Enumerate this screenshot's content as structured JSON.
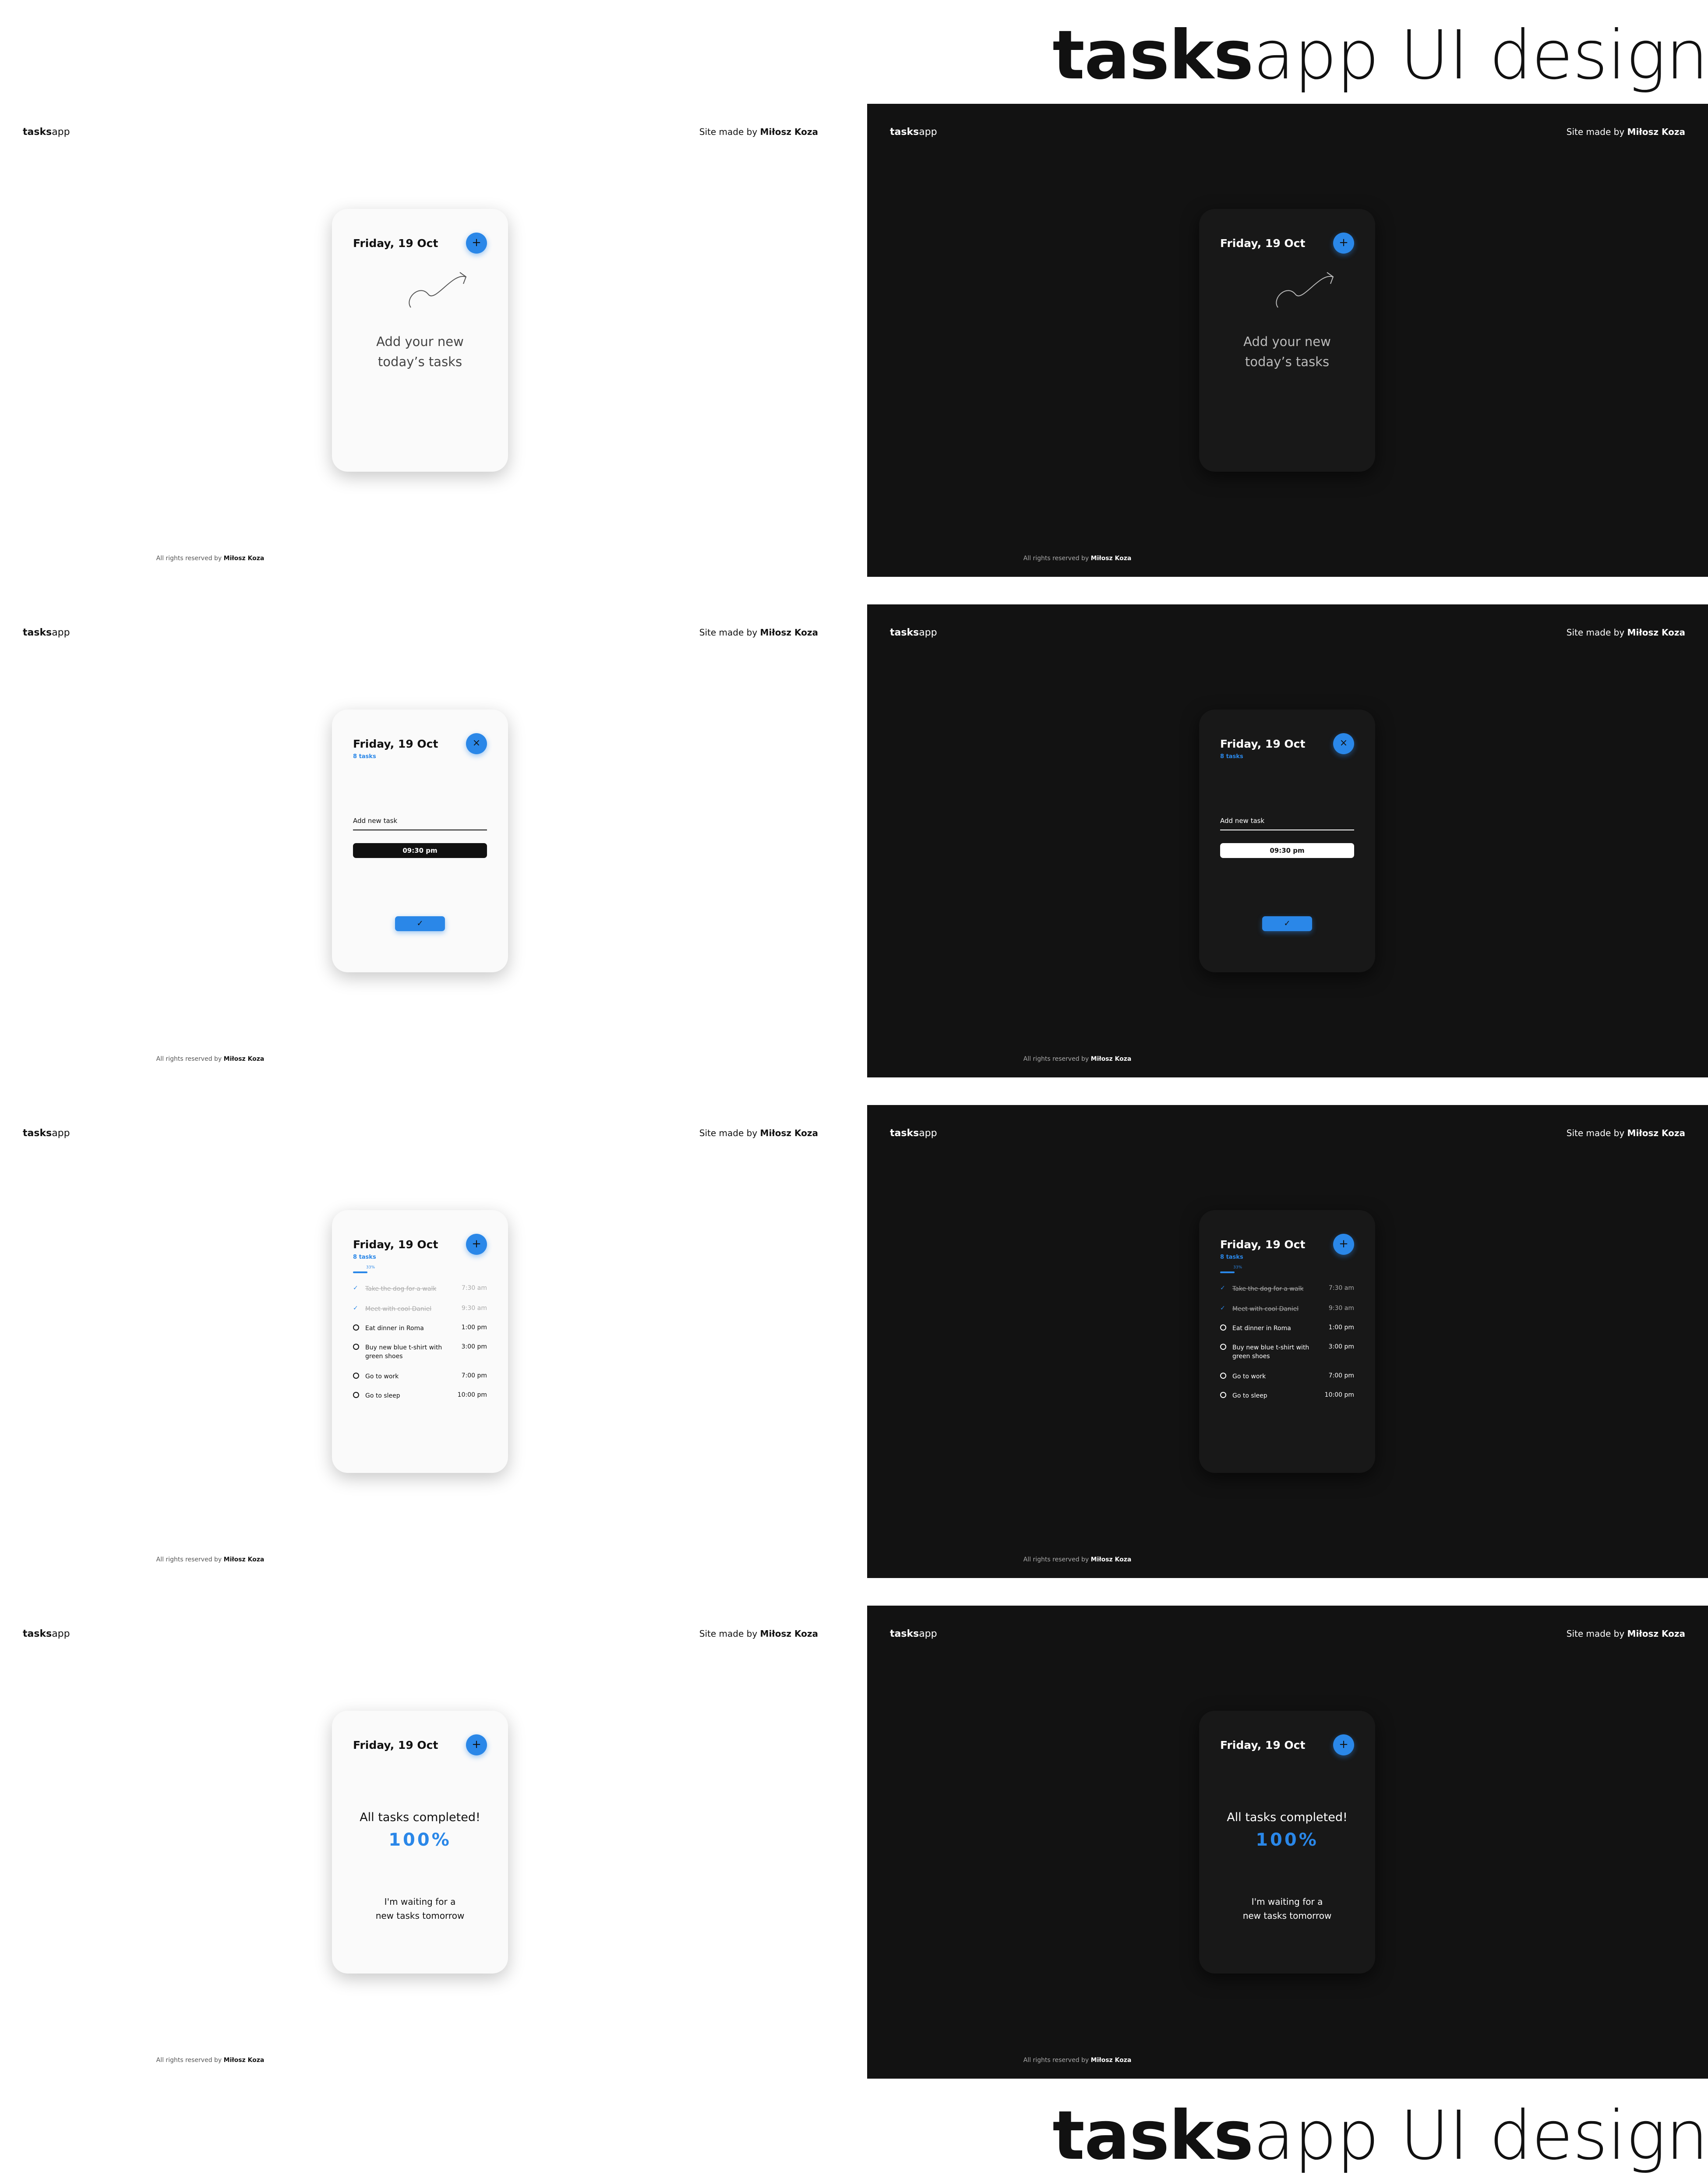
{
  "page_title": {
    "bold": "tasks",
    "light": "app UI design"
  },
  "brand": {
    "bold": "tasks",
    "light": "app"
  },
  "credit": {
    "prefix": "Site made by ",
    "name": "Miłosz Koza"
  },
  "footer": {
    "prefix": "All rights reserved by ",
    "name": "Miłosz Koza"
  },
  "colors": {
    "accent": "#2a87e8",
    "dark_bg": "#121212",
    "light_bg": "#ffffff"
  },
  "screens": {
    "empty": {
      "date": "Friday, 19 Oct",
      "add_button_icon": "plus-icon",
      "message_line1": "Add your new",
      "message_line2": "today’s tasks"
    },
    "add": {
      "date": "Friday, 19 Oct",
      "count": "8 tasks",
      "close_button_icon": "close-icon",
      "input_placeholder": "Add new task",
      "time": "09:30 pm",
      "confirm_icon": "check-icon"
    },
    "list": {
      "date": "Friday, 19 Oct",
      "count": "8 tasks",
      "progress_label": "33%",
      "progress": 0.33,
      "tasks": [
        {
          "text": "Take the dog for a walk",
          "time": "7:30 am",
          "done": true
        },
        {
          "text": "Meet with cool Daniel",
          "time": "9:30 am",
          "done": true
        },
        {
          "text": "Eat dinner in Roma",
          "time": "1:00 pm",
          "done": false
        },
        {
          "text": "Buy new blue t-shirt with green shoes",
          "time": "3:00 pm",
          "done": false
        },
        {
          "text": "Go to work",
          "time": "7:00 pm",
          "done": false
        },
        {
          "text": "Go to sleep",
          "time": "10:00 pm",
          "done": false
        }
      ]
    },
    "complete": {
      "date": "Friday, 19 Oct",
      "title": "All tasks completed!",
      "percent": "100%",
      "message_line1": "I'm waiting for a",
      "message_line2": "new tasks tomorrow"
    }
  }
}
